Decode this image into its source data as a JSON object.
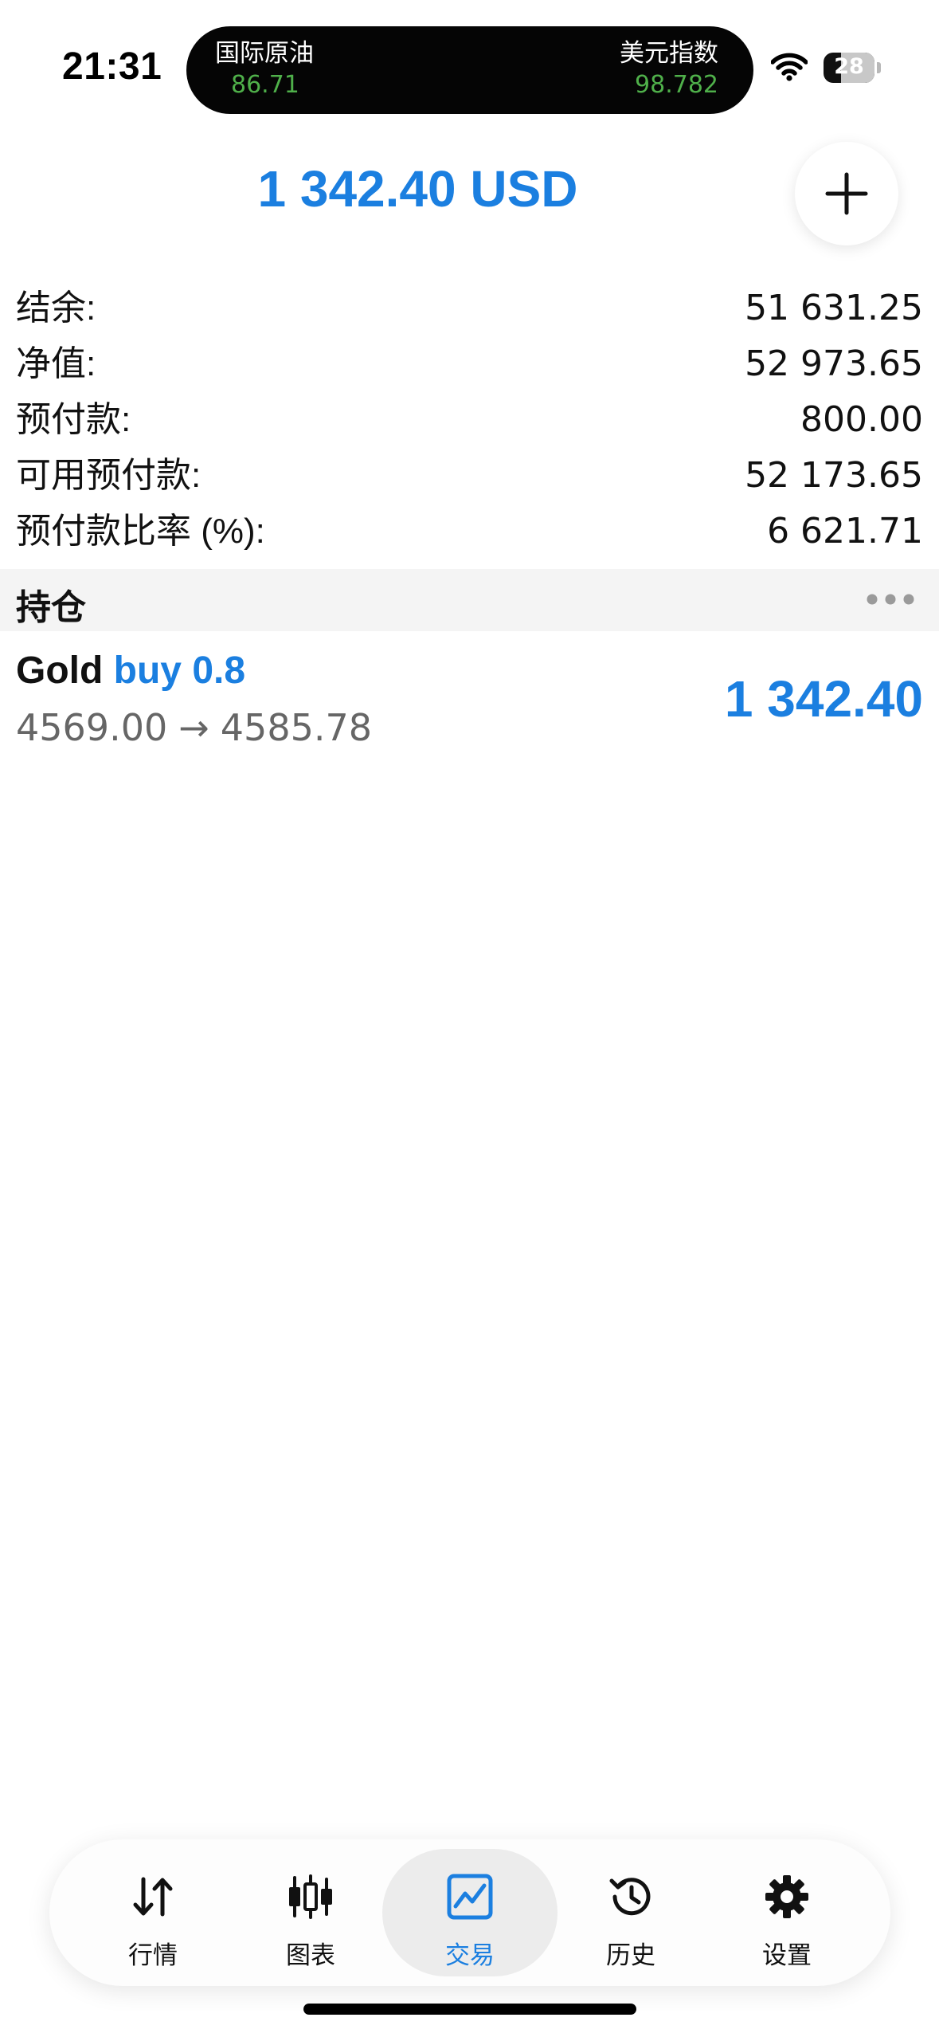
{
  "status_bar": {
    "time": "21:31",
    "battery": "28"
  },
  "ticker": {
    "left_label": "国际原油",
    "left_value": "86.71",
    "right_label": "美元指数",
    "right_value": "98.782",
    "value_color": "#4fb04a"
  },
  "header": {
    "total_profit": "1 342.40 USD",
    "add_icon": "plus-icon",
    "accent_color": "#1b7fe0"
  },
  "summary": [
    {
      "label": "结余:",
      "value": "51 631.25"
    },
    {
      "label": "净值:",
      "value": "52 973.65"
    },
    {
      "label": "预付款:",
      "value": "800.00"
    },
    {
      "label": "可用预付款:",
      "value": "52 173.65"
    },
    {
      "label": "预付款比率 (%):",
      "value": "6 621.71"
    }
  ],
  "positions": {
    "title": "持仓",
    "more_icon": "more-horizontal-icon",
    "items": [
      {
        "symbol": "Gold",
        "side": "buy 0.8",
        "open_price": "4569.00",
        "arrow": "→",
        "current_price": "4585.78",
        "profit": "1 342.40"
      }
    ]
  },
  "tabbar": {
    "active": "交易",
    "tabs": [
      {
        "label": "行情",
        "icon": "quotes-arrows-icon"
      },
      {
        "label": "图表",
        "icon": "candlestick-icon"
      },
      {
        "label": "交易",
        "icon": "trade-chart-icon"
      },
      {
        "label": "历史",
        "icon": "history-icon"
      },
      {
        "label": "设置",
        "icon": "gear-icon"
      }
    ]
  }
}
